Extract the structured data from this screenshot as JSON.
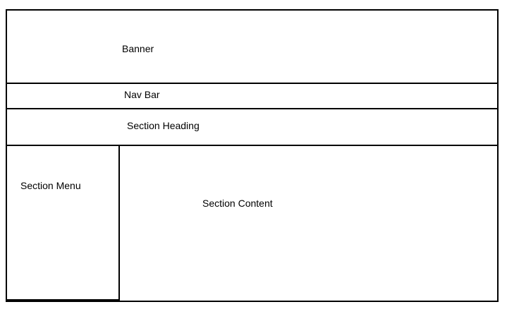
{
  "wireframe": {
    "banner": {
      "label": "Banner"
    },
    "nav_bar": {
      "label": "Nav Bar"
    },
    "section_heading": {
      "label": "Section Heading"
    },
    "section_menu": {
      "label": "Section Menu"
    },
    "section_content": {
      "label": "Section Content"
    }
  },
  "colors": {
    "stroke": "#000000",
    "background": "#ffffff"
  }
}
